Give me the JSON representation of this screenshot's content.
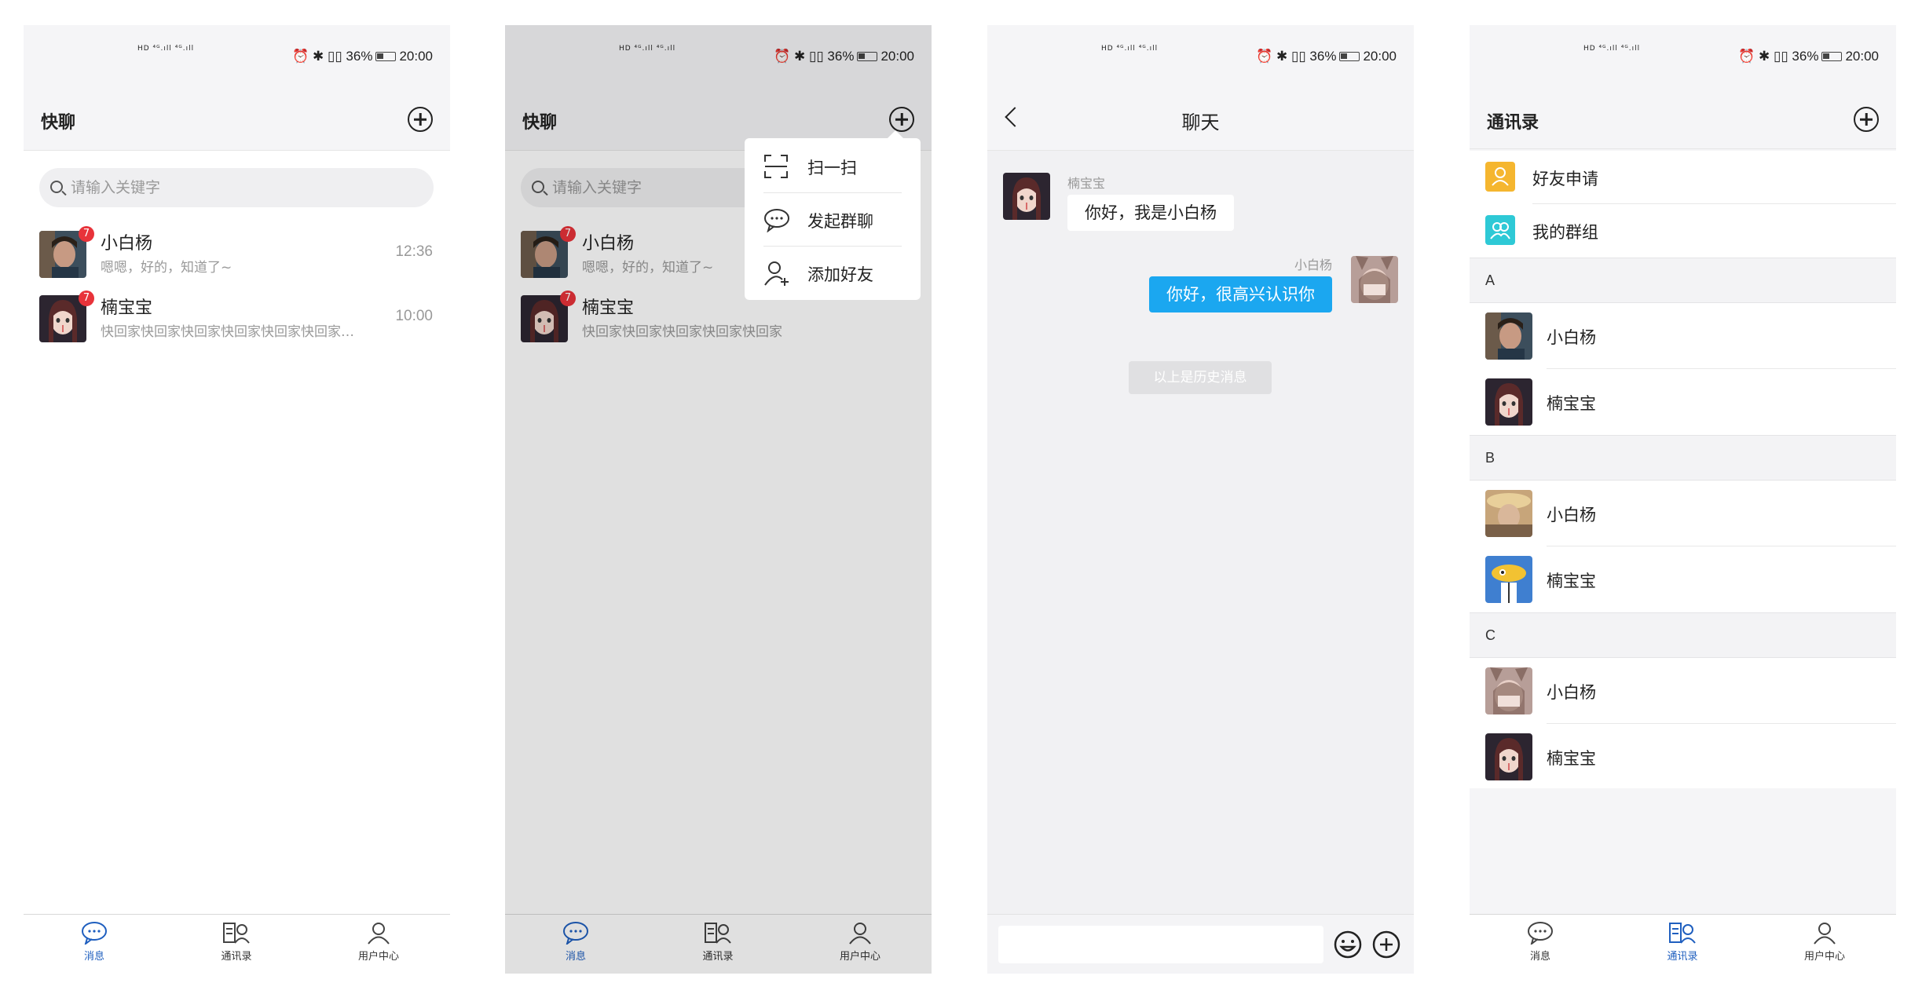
{
  "status_bar": {
    "right_text": "⏰ ✱ ▯▯ 36%",
    "time": "20:00",
    "signal": "HD ⁴ᴳ.ıll ⁴ᴳ.ıll"
  },
  "screens": {
    "messages": {
      "title": "快聊",
      "search_placeholder": "请输入关键字",
      "conversations": [
        {
          "name": "小白杨",
          "preview": "嗯嗯，好的，知道了~",
          "time": "12:36",
          "badge": "7"
        },
        {
          "name": "楠宝宝",
          "preview": "快回家快回家快回家快回家快回家快回家…",
          "time": "10:00",
          "badge": "7"
        }
      ]
    },
    "menu_screen": {
      "title": "快聊",
      "search_placeholder": "请输入关键字",
      "conversations": [
        {
          "name": "小白杨",
          "preview": "嗯嗯，好的，知道了~",
          "badge": "7"
        },
        {
          "name": "楠宝宝",
          "preview": "快回家快回家快回家快回家快回家",
          "badge": "7"
        }
      ],
      "menu": [
        {
          "label": "扫一扫",
          "icon": "scan-icon"
        },
        {
          "label": "发起群聊",
          "icon": "chat-bubble-icon"
        },
        {
          "label": "添加好友",
          "icon": "add-user-icon"
        }
      ]
    },
    "chat": {
      "title": "聊天",
      "messages": [
        {
          "sender": "楠宝宝",
          "text": "你好，我是小白杨",
          "side": "left"
        },
        {
          "sender": "小白杨",
          "text": "你好，很高兴认识你",
          "side": "right"
        }
      ],
      "history_label": "以上是历史消息"
    },
    "contacts": {
      "title": "通讯录",
      "top_items": [
        {
          "label": "好友申请",
          "icon": "friend-request-icon",
          "color": "#f5b62f"
        },
        {
          "label": "我的群组",
          "icon": "group-icon",
          "color": "#2ec9d6"
        }
      ],
      "sections": [
        {
          "letter": "A",
          "people": [
            "小白杨",
            "楠宝宝"
          ]
        },
        {
          "letter": "B",
          "people": [
            "小白杨",
            "楠宝宝"
          ]
        },
        {
          "letter": "C",
          "people": [
            "小白杨",
            "楠宝宝"
          ]
        }
      ]
    }
  },
  "tabs": [
    {
      "label": "消息",
      "icon": "message-icon"
    },
    {
      "label": "通讯录",
      "icon": "contacts-icon"
    },
    {
      "label": "用户中心",
      "icon": "user-icon"
    }
  ],
  "colors": {
    "accent": "#1f5fbf",
    "bubble_right": "#1ba7f0",
    "badge": "#e8333a"
  }
}
